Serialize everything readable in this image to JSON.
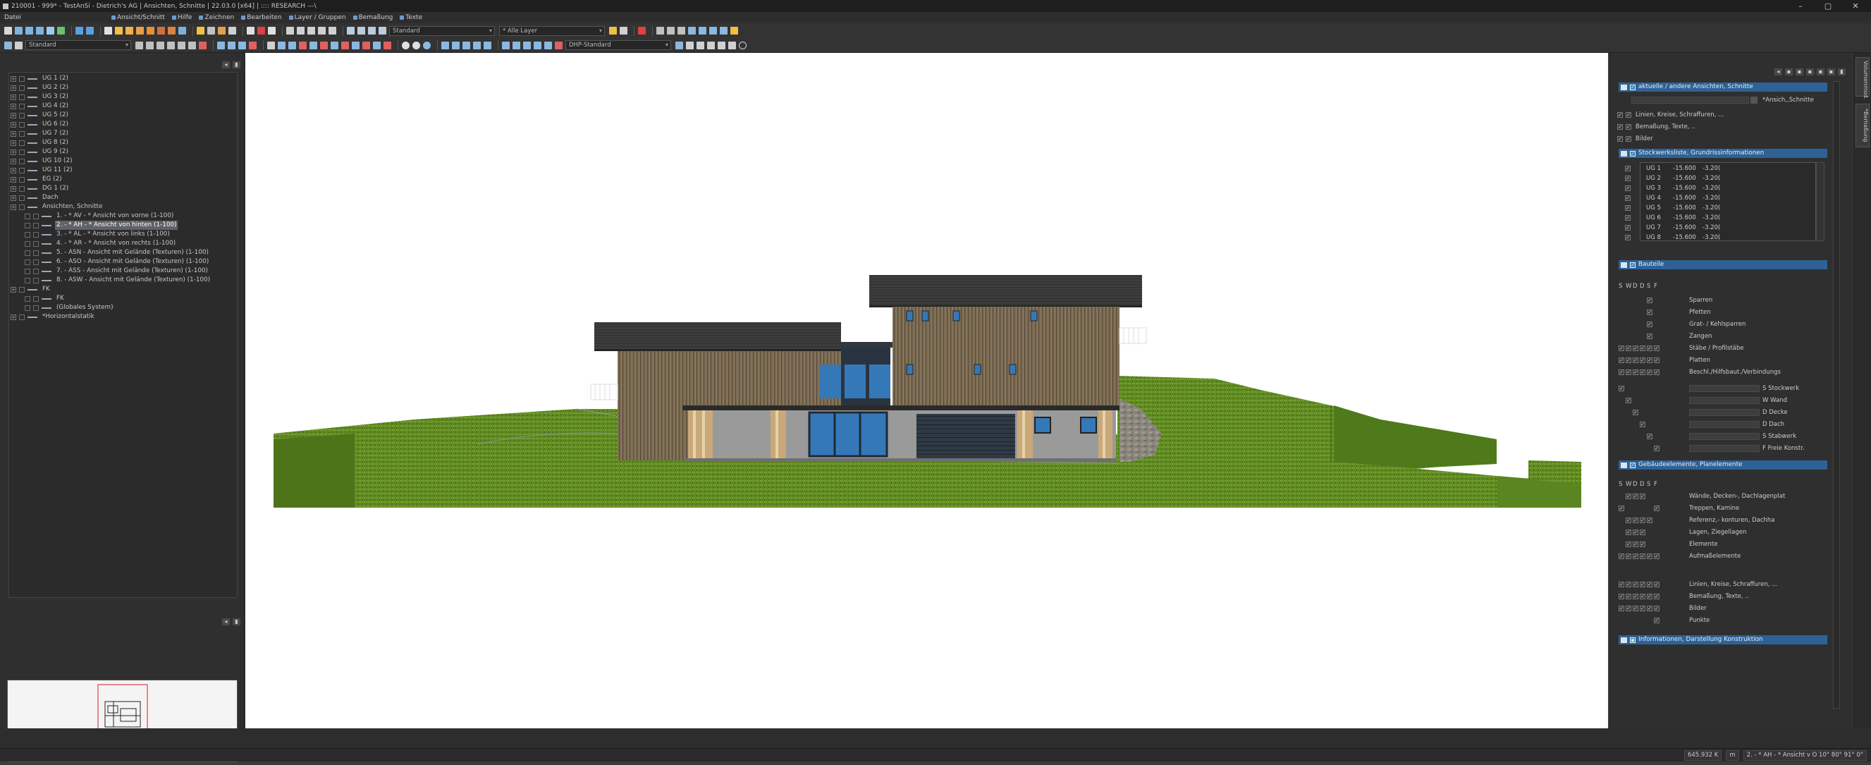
{
  "window": {
    "title": "210001 - 999* - TestAnSi - Dietrich's AG | Ansichten, Schnitte | 22.03.0 [x64] | :::: RESEARCH ---\\",
    "controls": [
      "–",
      "▢",
      "✕"
    ]
  },
  "menu": [
    {
      "label": "Datei",
      "icon": "file-icon"
    },
    {
      "label": "Ansicht/Schnitt",
      "icon": "view-icon"
    },
    {
      "label": "Hilfe",
      "icon": "help-icon"
    },
    {
      "label": "Zeichnen",
      "icon": "draw-icon"
    },
    {
      "label": "Bearbeiten",
      "icon": "edit-icon"
    },
    {
      "label": "Layer / Gruppen",
      "icon": "layer-icon"
    },
    {
      "label": "Bemaßung",
      "icon": "dimension-icon"
    },
    {
      "label": "Texte",
      "icon": "text-icon"
    }
  ],
  "toolbar1": {
    "combo1": "Standard",
    "combo2": "* Alle Layer"
  },
  "toolbar2": {
    "combo1": "Standard",
    "combo2": "DHP-Standard"
  },
  "left_panel": {
    "tree": [
      {
        "label": "UG 1 (2)",
        "level": 0
      },
      {
        "label": "UG 2 (2)",
        "level": 0
      },
      {
        "label": "UG 3 (2)",
        "level": 0
      },
      {
        "label": "UG 4 (2)",
        "level": 0
      },
      {
        "label": "UG 5 (2)",
        "level": 0
      },
      {
        "label": "UG 6 (2)",
        "level": 0
      },
      {
        "label": "UG 7 (2)",
        "level": 0
      },
      {
        "label": "UG 8 (2)",
        "level": 0
      },
      {
        "label": "UG 9 (2)",
        "level": 0
      },
      {
        "label": "UG 10 (2)",
        "level": 0
      },
      {
        "label": "UG 11 (2)",
        "level": 0
      },
      {
        "label": "EG (2)",
        "level": 0
      },
      {
        "label": "DG 1 (2)",
        "level": 0
      },
      {
        "label": "Dach",
        "level": 0
      },
      {
        "label": "Ansichten, Schnitte",
        "level": 0
      },
      {
        "label": "1. - * AV - * Ansicht von vorne (1-100)",
        "level": 1
      },
      {
        "label": "2. - * AH - * Ansicht von hinten (1-100)",
        "level": 1,
        "selected": true
      },
      {
        "label": "3. - * AL - * Ansicht von links (1-100)",
        "level": 1
      },
      {
        "label": "4. - * AR - * Ansicht von rechts (1-100)",
        "level": 1
      },
      {
        "label": "5. - ASN - Ansicht mit Gelände (Texturen) (1-100)",
        "level": 1
      },
      {
        "label": "6. - ASO - Ansicht mit Gelände (Texturen) (1-100)",
        "level": 1
      },
      {
        "label": "7. - ASS - Ansicht mit Gelände (Texturen) (1-100)",
        "level": 1
      },
      {
        "label": "8. - ASW - Ansicht mit Gelände (Texturen) (1-100)",
        "level": 1
      },
      {
        "label": "FK",
        "level": 0
      },
      {
        "label": "FK",
        "level": 1
      },
      {
        "label": "(Globales System)",
        "level": 1
      },
      {
        "label": "*Horizontalstatik",
        "level": 0
      }
    ]
  },
  "right_panel": {
    "sections": {
      "s1": "aktuelle / andere Ansichten, Schnitte",
      "s2": "Stockwerksliste, Grundrissinformationen",
      "s3": "Bauteile",
      "s4": "Gebäudeelemente, Planelemente",
      "s5": "Informationen, Darstellung Konstruktion"
    },
    "view_field": "*Ansich,,Schnitte",
    "view_items": [
      "Linien, Kreise, Schraffuren, ...",
      "Bemaßung, Texte, ..",
      "Bilder"
    ],
    "floors": [
      {
        "name": "UG 1",
        "a": "-15.600",
        "b": "-3.20("
      },
      {
        "name": "UG 2",
        "a": "-15.600",
        "b": "-3.20("
      },
      {
        "name": "UG 3",
        "a": "-15.600",
        "b": "-3.20("
      },
      {
        "name": "UG 4",
        "a": "-15.600",
        "b": "-3.20("
      },
      {
        "name": "UG 5",
        "a": "-15.600",
        "b": "-3.20("
      },
      {
        "name": "UG 6",
        "a": "-15.600",
        "b": "-3.20("
      },
      {
        "name": "UG 7",
        "a": "-15.600",
        "b": "-3.20("
      },
      {
        "name": "UG 8",
        "a": "-15.600",
        "b": "-3.20("
      }
    ],
    "columns": [
      "S",
      "W",
      "D",
      "D",
      "S",
      "F"
    ],
    "bauteile": [
      "Sparren",
      "Pfetten",
      "Grat- / Kehlsparren",
      "Zangen",
      "Stäbe / Profilstäbe",
      "Platten",
      "Beschl./Hilfsbaut./Verbindungs"
    ],
    "bauteile_fields": [
      "S Stockwerk",
      "W Wand",
      "D Decke",
      "D Dach",
      "S Stabwerk",
      "F Freie Konstr."
    ],
    "gebaeude": [
      "Wände, Decken-, Dachlagenplat",
      "Treppen, Kamine",
      "Referenz,- konturen, Dachha",
      "Lagen, Ziegellagen",
      "Elemente",
      "Aufmaßelemente"
    ],
    "gebaeude2": [
      "Linien, Kreise, Schraffuren, ...",
      "Bemaßung, Texte, ..",
      "Bilder",
      "Punkte"
    ]
  },
  "right_strip": {
    "tab1": "Volumenmod.",
    "tab2": "*Bemaßung"
  },
  "statusbar": {
    "zoom": "645.932 K",
    "unit": "m",
    "view": "2. - * AH - * Ansicht v O 10° 80° 91° 0°"
  }
}
